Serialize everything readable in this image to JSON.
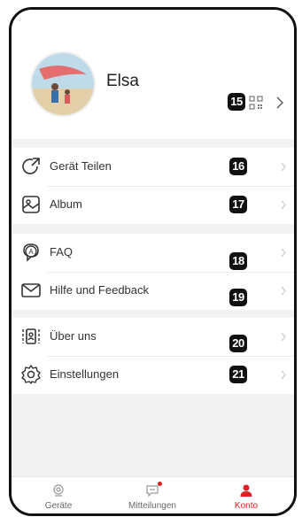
{
  "profile": {
    "name": "Elsa"
  },
  "badges": [
    "15",
    "16",
    "17",
    "18",
    "19",
    "20",
    "21"
  ],
  "menu": {
    "group1": [
      {
        "label": "Gerät Teilen",
        "icon": "share-arrow-icon"
      },
      {
        "label": "Album",
        "icon": "album-icon"
      }
    ],
    "group2": [
      {
        "label": "FAQ",
        "icon": "faq-icon"
      },
      {
        "label": "Hilfe und Feedback",
        "icon": "mail-icon"
      }
    ],
    "group3": [
      {
        "label": "Über uns",
        "icon": "about-icon"
      },
      {
        "label": "Einstellungen",
        "icon": "gear-icon"
      }
    ]
  },
  "tabs": [
    {
      "label": "Geräte",
      "icon": "device-icon"
    },
    {
      "label": "Mitteilungen",
      "icon": "message-icon"
    },
    {
      "label": "Konto",
      "icon": "person-icon",
      "active": true
    }
  ],
  "colors": {
    "accent": "#e02020",
    "background": "#f2f2f2"
  }
}
